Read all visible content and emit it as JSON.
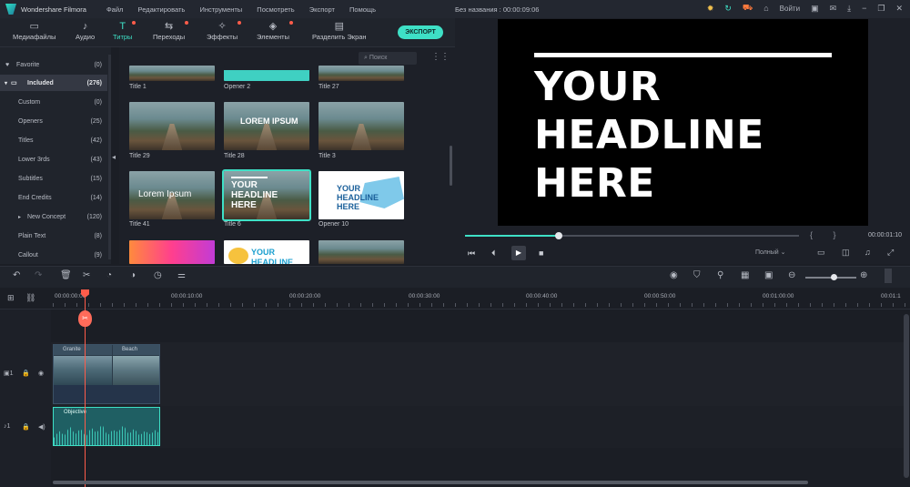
{
  "titlebar": {
    "app_name": "Wondershare Filmora",
    "menu": [
      "Файл",
      "Редактировать",
      "Инструменты",
      "Посмотреть",
      "Экспорт",
      "Помощь"
    ],
    "document": "Без названия : 00:00:09:06",
    "login": "Войти"
  },
  "toolbar": {
    "tabs": [
      "Медиафайлы",
      "Аудио",
      "Титры",
      "Переходы",
      "Эффекты",
      "Элементы",
      "Разделить Экран"
    ],
    "export_label": "ЭКСПОРТ"
  },
  "sidebar": {
    "items": [
      {
        "label": "Favorite",
        "count": "(0)"
      },
      {
        "label": "Included",
        "count": "(276)"
      },
      {
        "label": "Custom",
        "count": "(0)"
      },
      {
        "label": "Openers",
        "count": "(25)"
      },
      {
        "label": "Titles",
        "count": "(42)"
      },
      {
        "label": "Lower 3rds",
        "count": "(43)"
      },
      {
        "label": "Subtitles",
        "count": "(15)"
      },
      {
        "label": "End Credits",
        "count": "(14)"
      },
      {
        "label": "New Concept",
        "count": "(120)"
      },
      {
        "label": "Plain Text",
        "count": "(8)"
      },
      {
        "label": "Callout",
        "count": "(9)"
      }
    ]
  },
  "library": {
    "search_placeholder": "Поиск",
    "thumbs": [
      {
        "label": "Title 1",
        "text": ""
      },
      {
        "label": "Opener 2",
        "text": ""
      },
      {
        "label": "Title 27",
        "text": ""
      },
      {
        "label": "Title 29",
        "text": ""
      },
      {
        "label": "Title 28",
        "text": "LOREM IPSUM"
      },
      {
        "label": "Title 3",
        "text": ""
      },
      {
        "label": "Title 41",
        "text": "Lorem Ipsum"
      },
      {
        "label": "Title 6",
        "text": "YOUR HEADLINE HERE"
      },
      {
        "label": "Opener 10",
        "text": "YOUR HEADLINE HERE"
      },
      {
        "label": "",
        "text": ""
      },
      {
        "label": "",
        "text": "YOUR HEADLINE"
      },
      {
        "label": "",
        "text": ""
      }
    ]
  },
  "preview": {
    "headline": "YOUR HEADLINE HERE",
    "progress": 0.28,
    "brackets": "{ }",
    "timecode": "00:00:01:10",
    "quality": "Полный"
  },
  "timeline": {
    "ruler_labels": [
      "00:00:00:00",
      "00:00:10:00",
      "00:00:20:00",
      "00:00:30:00",
      "00:00:40:00",
      "00:00:50:00",
      "00:01:00:00",
      "00:01:1"
    ],
    "video_clips": [
      "Granite",
      "Beach"
    ],
    "audio_clip": "Objective",
    "video_track": "1",
    "audio_track": "1"
  },
  "colors": {
    "accent": "#3ee0c6",
    "playhead": "#ff5c4a",
    "background": "#1b1e25"
  }
}
